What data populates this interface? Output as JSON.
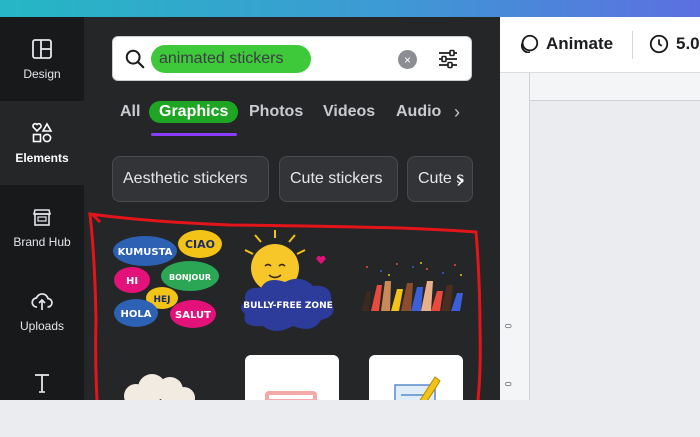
{
  "rail": {
    "items": [
      {
        "label": "Design",
        "icon": "layout-icon"
      },
      {
        "label": "Elements",
        "icon": "shapes-icon"
      },
      {
        "label": "Brand Hub",
        "icon": "brand-icon"
      },
      {
        "label": "Uploads",
        "icon": "cloud-upload-icon"
      },
      {
        "label": "",
        "icon": "text-icon"
      }
    ]
  },
  "search": {
    "value": "animated stickers",
    "clear_icon": "×"
  },
  "tabs": {
    "items": [
      "All",
      "Graphics",
      "Photos",
      "Videos",
      "Audio"
    ],
    "next": "›",
    "active": "Graphics"
  },
  "chips": {
    "items": [
      "Aesthetic stickers",
      "Cute stickers",
      "Cute s"
    ],
    "next": "›"
  },
  "stickers": {
    "bubbles": [
      "KUMUSTA",
      "CIAO",
      "HI",
      "BONJOUR",
      "HEJ",
      "HOLA",
      "SALUT"
    ],
    "bully_free": "BULLY-FREE ZONE"
  },
  "toolbar": {
    "animate_label": "Animate",
    "timer_label": "5.0"
  },
  "ruler": {
    "v_marks": [
      "0",
      "0"
    ]
  },
  "colors": {
    "accent": "#8b3dff",
    "annotation": "#e3151a",
    "highlight": "#3ec93a"
  }
}
